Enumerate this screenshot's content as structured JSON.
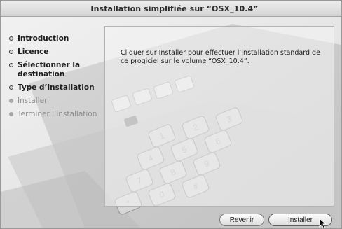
{
  "window": {
    "title": "Installation simplifiée sur “OSX_10.4”"
  },
  "sidebar": {
    "steps": [
      {
        "label": "Introduction",
        "state": "done"
      },
      {
        "label": "Licence",
        "state": "done"
      },
      {
        "label": "Sélectionner la destination",
        "state": "done"
      },
      {
        "label": "Type d’installation",
        "state": "done"
      },
      {
        "label": "Installer",
        "state": "pending"
      },
      {
        "label": "Terminer l’installation",
        "state": "pending"
      }
    ]
  },
  "content": {
    "message": "Cliquer sur Installer pour effectuer l’installation standard de ce progiciel sur le volume “OSX_10.4”."
  },
  "buttons": {
    "back": "Revenir",
    "install": "Installer"
  },
  "keypad_keys": [
    "1",
    "2",
    "3",
    "4",
    "5",
    "6",
    "7",
    "8",
    "9",
    "*",
    "0",
    "#"
  ]
}
